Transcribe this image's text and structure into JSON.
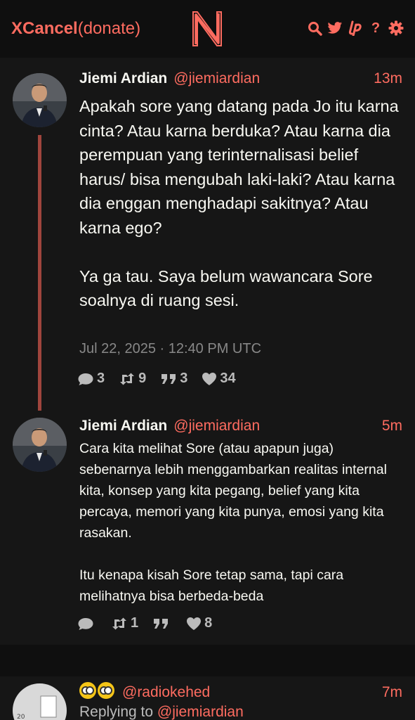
{
  "header": {
    "brand_bold": "XCancel",
    "brand_rest": "(donate)",
    "logo_letter": "N",
    "icons": [
      "search-icon",
      "twitter-bird-icon",
      "liberapay-icon",
      "help-icon",
      "settings-icon"
    ]
  },
  "tweets": [
    {
      "fullname": "Jiemi Ardian",
      "username": "@jiemiardian",
      "time": "13m",
      "text": "Apakah sore yang datang pada Jo itu karna cinta? Atau karna berduka? Atau karna dia perempuan yang terinternalisasi belief harus/ bisa mengubah laki-laki? Atau karna dia enggan menghadapi sakitnya? Atau karna ego?\n\nYa ga tau. Saya belum wawancara Sore soalnya di ruang sesi.",
      "date": "Jul 22, 2025 · 12:40 PM UTC",
      "replies": "3",
      "retweets": "9",
      "quotes": "3",
      "likes": "34"
    },
    {
      "fullname": "Jiemi Ardian",
      "username": "@jiemiardian",
      "time": "5m",
      "text": "Cara kita melihat Sore (atau apapun juga) sebenarnya lebih menggambarkan realitas internal kita, konsep yang kita pegang, belief yang kita percaya, memori yang kita punya, emosi yang kita rasakan.\n\nItu kenapa kisah Sore tetap sama, tapi cara melihatnya bisa berbeda-beda",
      "replies": "",
      "retweets": "1",
      "quotes": "",
      "likes": "8"
    },
    {
      "username": "@radiokehed",
      "time": "7m",
      "replying_prefix": "Replying to ",
      "replying_to": "@jiemiardian"
    }
  ],
  "colors": {
    "accent": "#ff6c60",
    "background": "#0f0f0f",
    "panel": "#161616",
    "thread": "#a0453d"
  }
}
